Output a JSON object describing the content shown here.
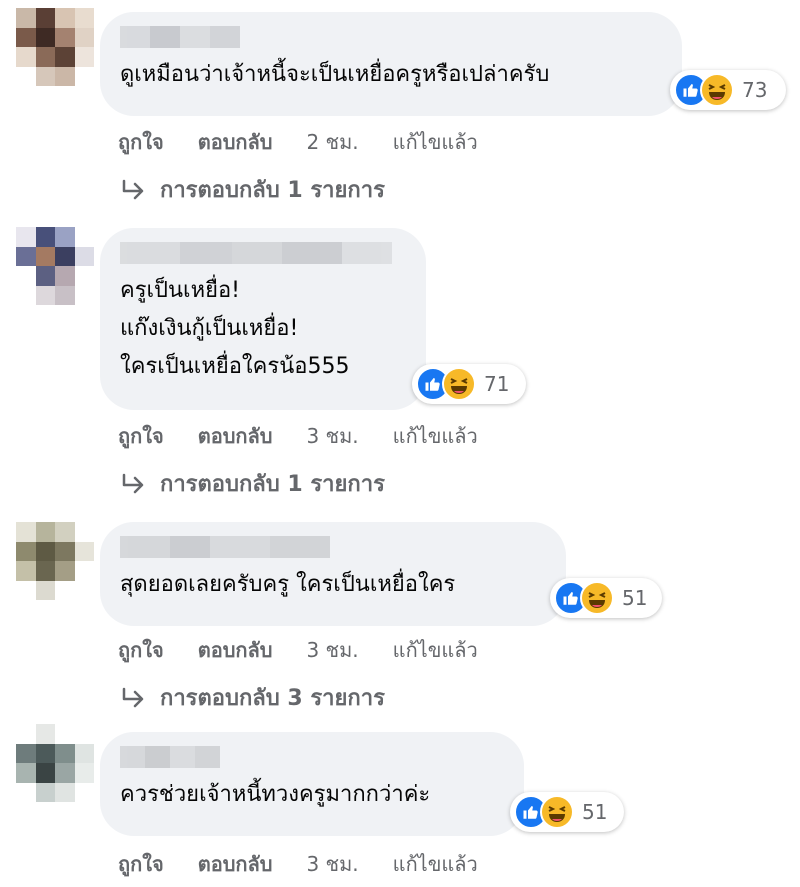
{
  "comments": [
    {
      "text": "ดูเหมือนว่าเจ้าหนี้จะเป็นเหยื่อครูหรือเปล่าครับ",
      "reaction_count": "73",
      "actions": {
        "like": "ถูกใจ",
        "reply": "ตอบกลับ",
        "time": "2 ชม.",
        "edited": "แก้ไขแล้ว"
      },
      "replies_label": "การตอบกลับ 1 รายการ"
    },
    {
      "text": "ครูเป็นเหยื่อ!\nแก๊งเงินกู้เป็นเหยื่อ!\nใครเป็นเหยื่อใครน้อ555",
      "reaction_count": "71",
      "actions": {
        "like": "ถูกใจ",
        "reply": "ตอบกลับ",
        "time": "3 ชม.",
        "edited": "แก้ไขแล้ว"
      },
      "replies_label": "การตอบกลับ 1 รายการ"
    },
    {
      "text": "สุดยอดเลยครับครู ใครเป็นเหยื่อใคร",
      "reaction_count": "51",
      "actions": {
        "like": "ถูกใจ",
        "reply": "ตอบกลับ",
        "time": "3 ชม.",
        "edited": "แก้ไขแล้ว"
      },
      "replies_label": "การตอบกลับ 3 รายการ"
    },
    {
      "text": "ควรช่วยเจ้าหนี้ทวงครูมากกว่าค่ะ",
      "reaction_count": "51",
      "actions": {
        "like": "ถูกใจ",
        "reply": "ตอบกลับ",
        "time": "3 ชม.",
        "edited": "แก้ไขแล้ว"
      }
    }
  ],
  "colors": {
    "bubble": "#f0f2f5",
    "secondary_text": "#65676b",
    "like": "#1877f2",
    "haha": "#f7b928"
  },
  "icons": {
    "like": "like-icon",
    "haha": "haha-icon",
    "reply_arrow": "reply-arrow-icon"
  }
}
